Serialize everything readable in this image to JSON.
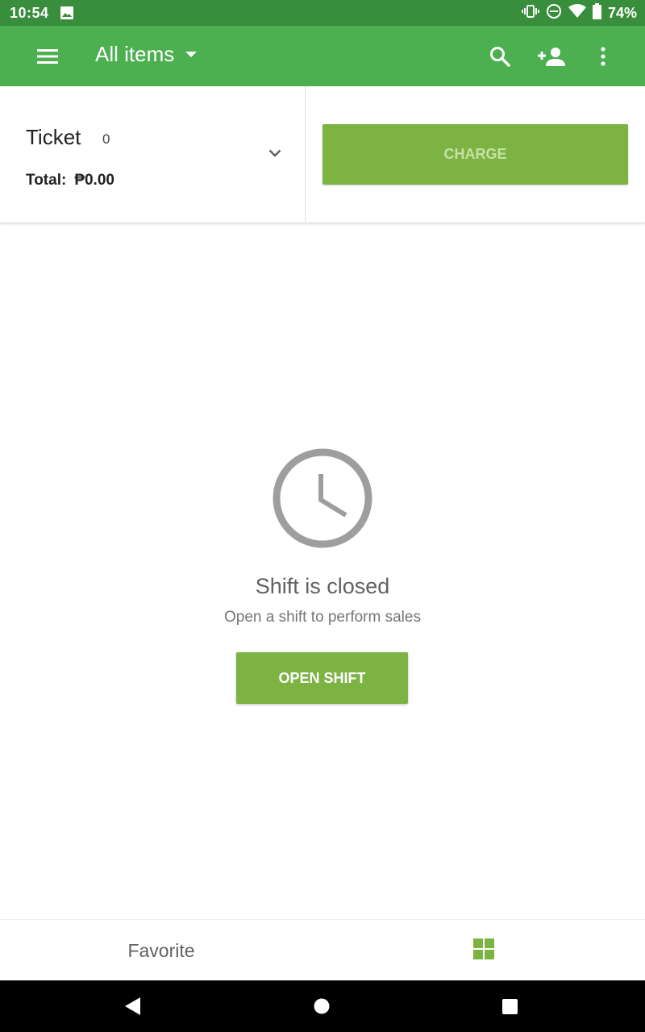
{
  "status_bar": {
    "time": "10:54",
    "battery": "74%"
  },
  "app_bar": {
    "title": "All items"
  },
  "ticket": {
    "title": "Ticket",
    "count": "0",
    "total_label": "Total:",
    "total_value": "₱0.00",
    "charge_label": "CHARGE"
  },
  "empty_state": {
    "title": "Shift is closed",
    "subtitle": "Open a shift to perform sales",
    "button_label": "OPEN SHIFT"
  },
  "bottom_tabs": {
    "favorite_label": "Favorite"
  },
  "icons": {
    "status": [
      "image-icon",
      "vibrate-icon",
      "dnd-icon",
      "wifi-icon",
      "battery-icon"
    ],
    "app_bar": [
      "menu-icon",
      "dropdown-arrow-icon",
      "search-icon",
      "add-customer-icon",
      "more-vert-icon"
    ],
    "nav": [
      "back-icon",
      "home-icon",
      "recents-icon"
    ]
  },
  "colors": {
    "status_bar": "#388e3c",
    "app_bar": "#4caf50",
    "button": "#7cb342",
    "charge_text": "#c5e1a5"
  }
}
